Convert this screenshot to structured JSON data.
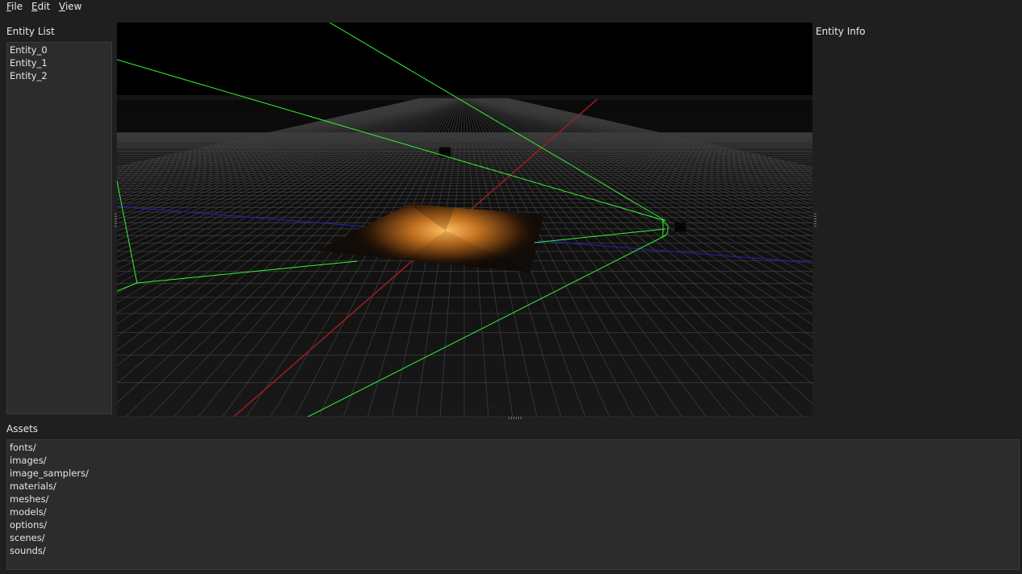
{
  "menu": {
    "items": [
      {
        "key": "F",
        "rest": "ile"
      },
      {
        "key": "E",
        "rest": "dit"
      },
      {
        "key": "V",
        "rest": "iew"
      }
    ]
  },
  "entity_panel": {
    "title": "Entity List",
    "items": [
      "Entity_0",
      "Entity_1",
      "Entity_2"
    ]
  },
  "info_panel": {
    "title": "Entity Info"
  },
  "assets_panel": {
    "title": "Assets",
    "items": [
      "fonts/",
      "images/",
      "image_samplers/",
      "materials/",
      "meshes/",
      "models/",
      "options/",
      "scenes/",
      "sounds/"
    ]
  },
  "colors": {
    "background": "#1f1f1f",
    "panel": "#2c2c2c",
    "frustum": "#3cff3c",
    "x_axis": "#b02020",
    "z_axis": "#2a2aa8",
    "grid": "#4a4a4a",
    "light_glow": "#ffb050"
  }
}
